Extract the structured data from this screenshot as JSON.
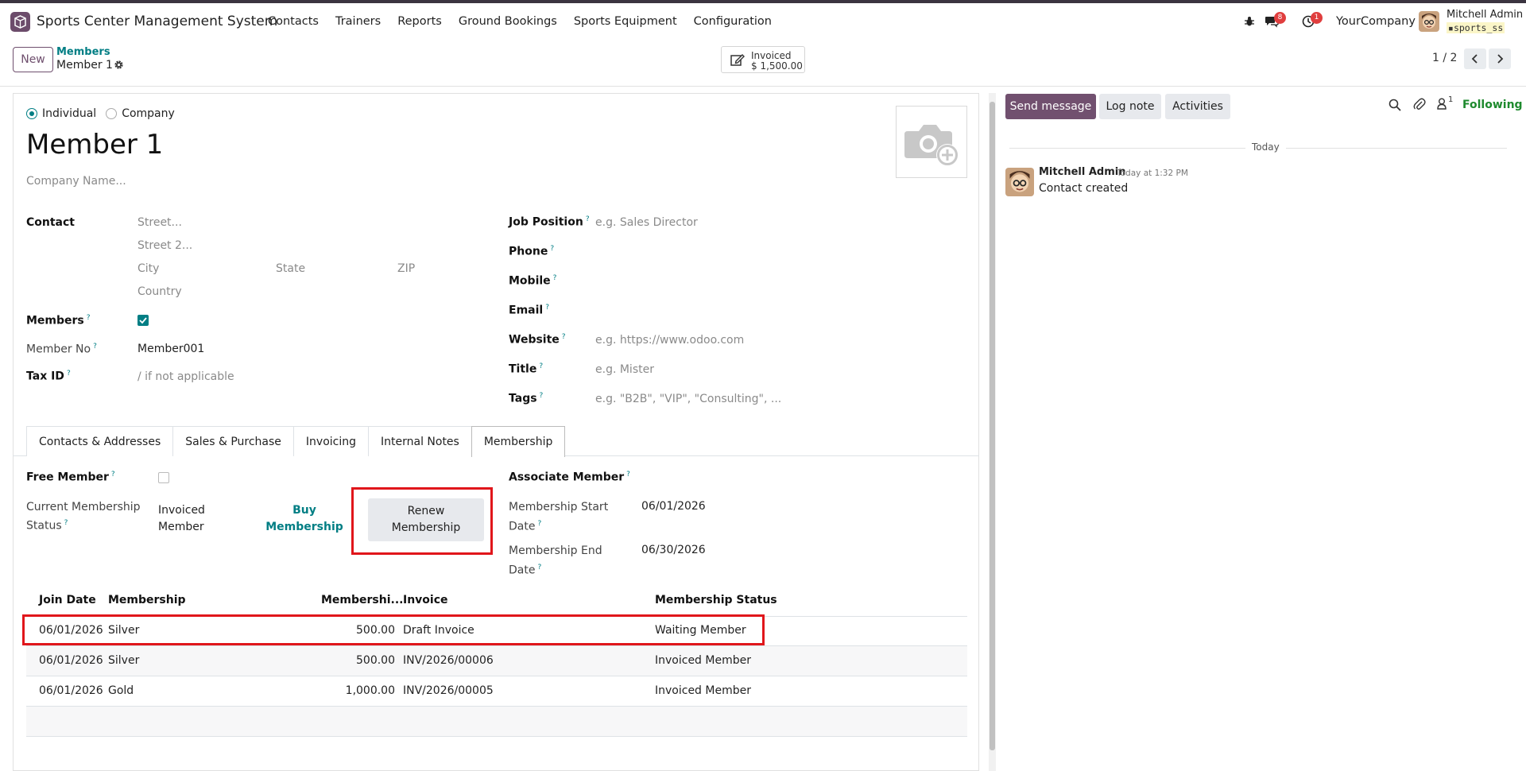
{
  "navbar": {
    "app_title": "Sports Center Management System",
    "menu": [
      "Contacts",
      "Trainers",
      "Reports",
      "Ground Bookings",
      "Sports Equipment",
      "Configuration"
    ],
    "messages_badge": "8",
    "activities_badge": "1",
    "company": "YourCompany",
    "user_name": "Mitchell Admin",
    "database": "sports_ss"
  },
  "control_panel": {
    "new_label": "New",
    "breadcrumb_parent": "Members",
    "breadcrumb_current": "Member 1",
    "smart_button": {
      "label": "Invoiced",
      "value": "$ 1,500.00"
    },
    "pager": "1 / 2"
  },
  "form": {
    "company_type": {
      "individual": "Individual",
      "company": "Company",
      "selected": "Individual"
    },
    "name": "Member 1",
    "company_name_placeholder": "Company Name...",
    "contact_label": "Contact",
    "address": {
      "street": "Street...",
      "street2": "Street 2...",
      "city": "City",
      "state": "State",
      "zip": "ZIP",
      "country": "Country"
    },
    "members_label": "Members",
    "members_checked": true,
    "member_no_label": "Member No",
    "member_no": "Member001",
    "tax_id_label": "Tax ID",
    "tax_id_placeholder": "/ if not applicable",
    "right": {
      "job_position_label": "Job Position",
      "job_position_placeholder": "e.g. Sales Director",
      "phone_label": "Phone",
      "mobile_label": "Mobile",
      "email_label": "Email",
      "website_label": "Website",
      "website_placeholder": "e.g. https://www.odoo.com",
      "title_label": "Title",
      "title_placeholder": "e.g. Mister",
      "tags_label": "Tags",
      "tags_placeholder": "e.g. \"B2B\", \"VIP\", \"Consulting\", ..."
    },
    "tabs": [
      "Contacts & Addresses",
      "Sales & Purchase",
      "Invoicing",
      "Internal Notes",
      "Membership"
    ],
    "active_tab": "Membership",
    "membership": {
      "free_member_label": "Free Member",
      "current_status_label_1": "Current Membership",
      "current_status_label_2": "Status",
      "current_status_1": "Invoiced",
      "current_status_2": "Member",
      "buy_label_1": "Buy",
      "buy_label_2": "Membership",
      "renew_label_1": "Renew",
      "renew_label_2": "Membership",
      "associate_label": "Associate Member",
      "start_label_1": "Membership Start",
      "start_label_2": "Date",
      "start_value": "06/01/2026",
      "end_label_1": "Membership End",
      "end_label_2": "Date",
      "end_value": "06/30/2026"
    },
    "lines": {
      "columns": [
        "Join Date",
        "Membership",
        "Membershi...",
        "Invoice",
        "Membership Status"
      ],
      "rows": [
        {
          "join_date": "06/01/2026",
          "membership": "Silver",
          "fee": "500.00",
          "invoice": "Draft Invoice",
          "status": "Waiting Member"
        },
        {
          "join_date": "06/01/2026",
          "membership": "Silver",
          "fee": "500.00",
          "invoice": "INV/2026/00006",
          "status": "Invoiced Member"
        },
        {
          "join_date": "06/01/2026",
          "membership": "Gold",
          "fee": "1,000.00",
          "invoice": "INV/2026/00005",
          "status": "Invoiced Member"
        }
      ]
    }
  },
  "chatter": {
    "send_message": "Send message",
    "log_note": "Log note",
    "activities": "Activities",
    "followers_count": "1",
    "following": "Following",
    "date_separator": "Today",
    "message": {
      "author": "Mitchell Admin",
      "time": "Today at 1:32 PM",
      "body": "Contact created"
    }
  },
  "colors": {
    "primary": "#6f4f6e",
    "accent": "#017e84",
    "highlight": "#e0161b",
    "following": "#1e8a2e"
  }
}
